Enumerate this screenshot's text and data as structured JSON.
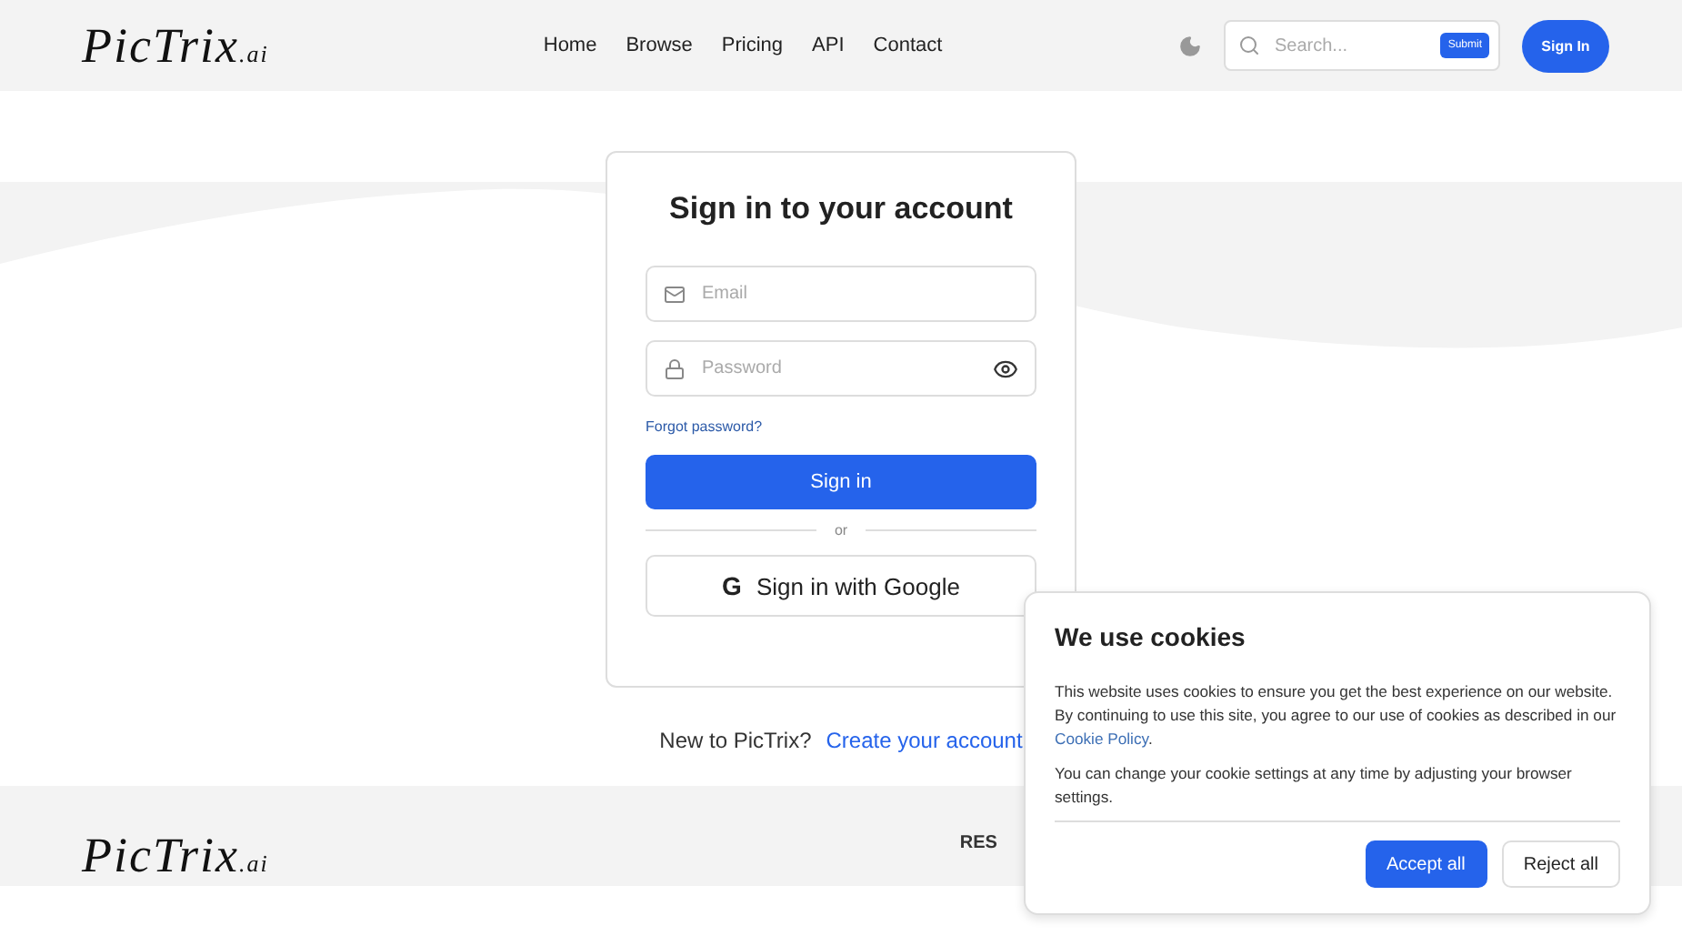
{
  "header": {
    "logo": {
      "name": "PicTrix",
      "suffix": ".ai"
    },
    "nav": [
      {
        "label": "Home"
      },
      {
        "label": "Browse"
      },
      {
        "label": "Pricing"
      },
      {
        "label": "API"
      },
      {
        "label": "Contact"
      }
    ],
    "search": {
      "placeholder": "Search...",
      "button": "Submit"
    },
    "sign_in": "Sign In"
  },
  "login": {
    "title": "Sign in to your account",
    "fields": [
      {
        "kind": "email",
        "placeholder": "Email"
      },
      {
        "kind": "password",
        "placeholder": "Password"
      }
    ],
    "forgot": "Forgot password?",
    "submit": "Sign in",
    "divider": "or",
    "google_icon": "G",
    "google": "Sign in with Google",
    "signup_prompt": "New to PicTrix?",
    "signup_link": "Create your account"
  },
  "footer": {
    "logo": {
      "name": "PicTrix",
      "suffix": ".ai"
    },
    "heading": "RES"
  },
  "cookies": {
    "title": "We use cookies",
    "text": "This website uses cookies to ensure you get the best experience on our website. By continuing to use this site, you agree to our use of cookies as described in our",
    "link": "Cookie Policy",
    "after_link": ".",
    "note": "You can change your cookie settings at any time by adjusting your browser settings.",
    "buttons": [
      {
        "kind": "primary",
        "label": "Accept all"
      },
      {
        "kind": "secondary",
        "label": "Reject all"
      }
    ]
  }
}
